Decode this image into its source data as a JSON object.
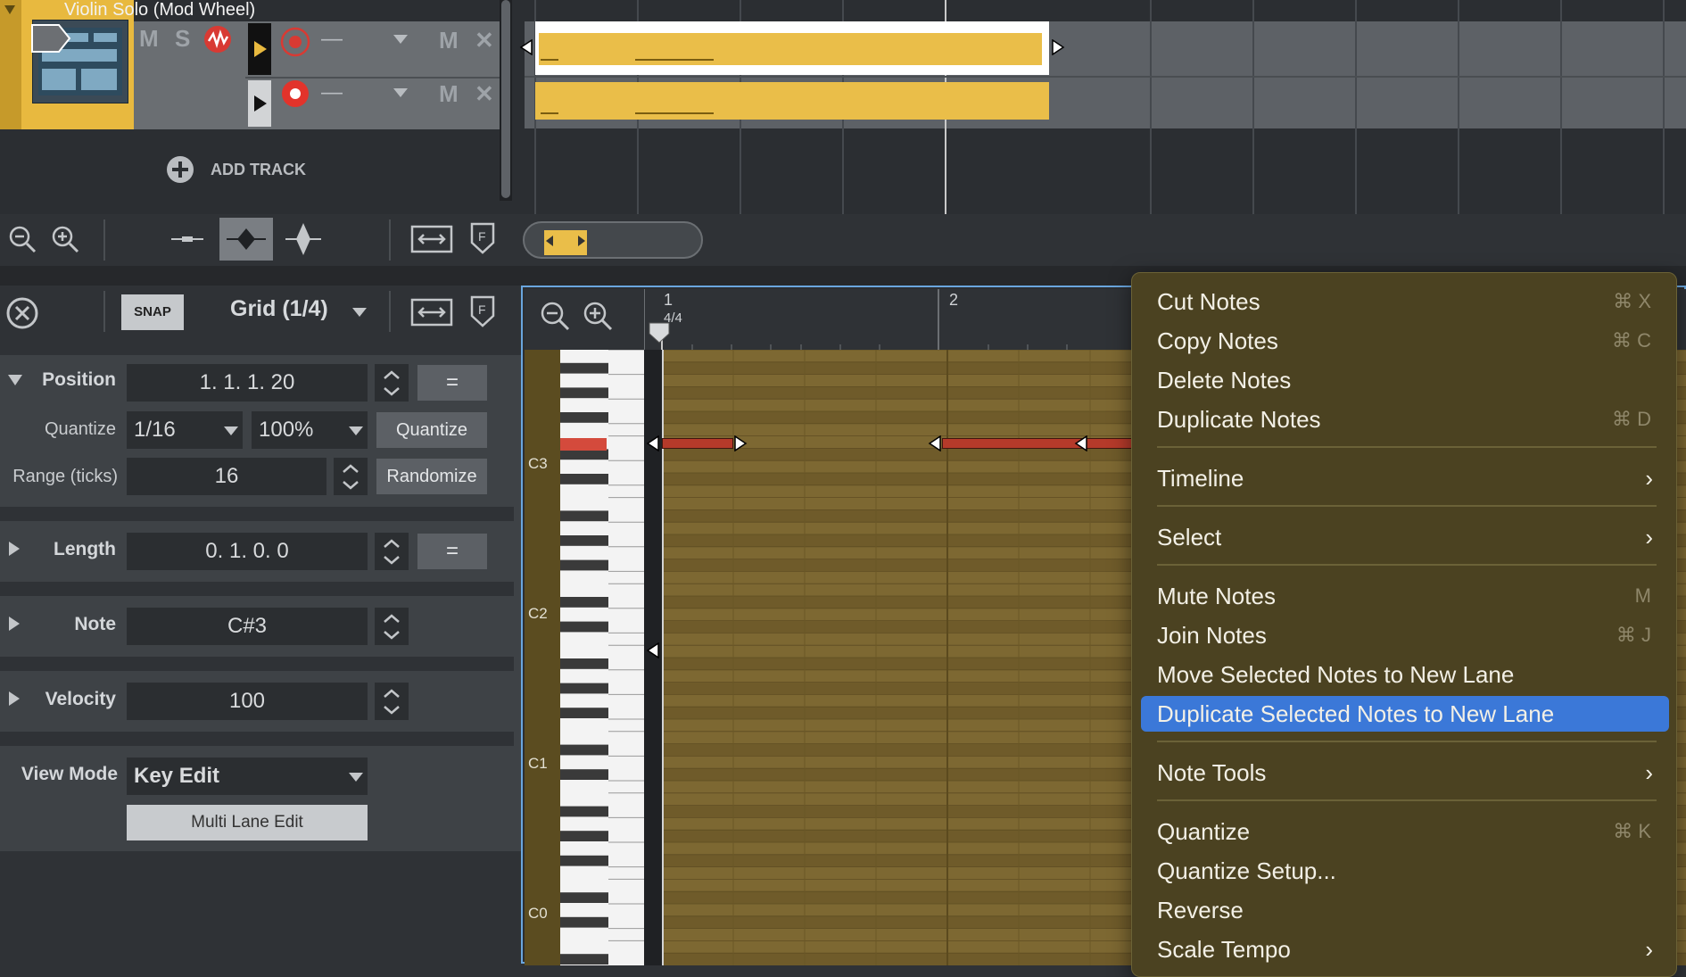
{
  "top": {
    "track_title": "Violin Solo (Mod Wheel)",
    "mute": "M",
    "solo": "S",
    "lane_mute": "M",
    "lane_close": "✕",
    "lane_dash": "—",
    "add_track": "ADD TRACK"
  },
  "inspector": {
    "snap": "SNAP",
    "grid": "Grid (1/4)",
    "position_label": "Position",
    "position_value": "1.  1.  1.  20",
    "equals": "=",
    "quantize_label": "Quantize",
    "quantize_value": "1/16",
    "quantize_strength": "100%",
    "quantize_button": "Quantize",
    "range_label": "Range (ticks)",
    "range_value": "16",
    "randomize_button": "Randomize",
    "length_label": "Length",
    "length_value": "0.  1.  0.    0",
    "note_label": "Note",
    "note_value": "C#3",
    "velocity_label": "Velocity",
    "velocity_value": "100",
    "view_mode_label": "View Mode",
    "view_mode_value": "Key Edit",
    "multi_lane": "Multi Lane Edit"
  },
  "editor": {
    "ruler": {
      "bar1": "1",
      "bar2": "2",
      "timesig": "4/4"
    },
    "octave_labels": [
      "C3",
      "C2",
      "C1",
      "C0"
    ]
  },
  "menu": {
    "items": [
      {
        "label": "Cut Notes",
        "shortcut": "⌘ X"
      },
      {
        "label": "Copy Notes",
        "shortcut": "⌘ C"
      },
      {
        "label": "Delete Notes",
        "shortcut": ""
      },
      {
        "label": "Duplicate Notes",
        "shortcut": "⌘ D"
      },
      {
        "label": "Timeline",
        "submenu": true
      },
      {
        "label": "Select",
        "submenu": true
      },
      {
        "label": "Mute Notes",
        "shortcut": "M"
      },
      {
        "label": "Join Notes",
        "shortcut": "⌘ J"
      },
      {
        "label": "Move Selected Notes to New Lane",
        "shortcut": ""
      },
      {
        "label": "Duplicate Selected Notes to New Lane",
        "shortcut": "",
        "highlighted": true
      },
      {
        "label": "Note Tools",
        "submenu": true
      },
      {
        "label": "Quantize",
        "shortcut": "⌘ K"
      },
      {
        "label": "Quantize Setup...",
        "shortcut": ""
      },
      {
        "label": "Reverse",
        "shortcut": ""
      },
      {
        "label": "Scale Tempo",
        "submenu": true
      }
    ]
  },
  "colors": {
    "accent": "#3b78d8",
    "clip": "#eabe49",
    "note": "#c0392b",
    "grid": "#7b6631"
  }
}
